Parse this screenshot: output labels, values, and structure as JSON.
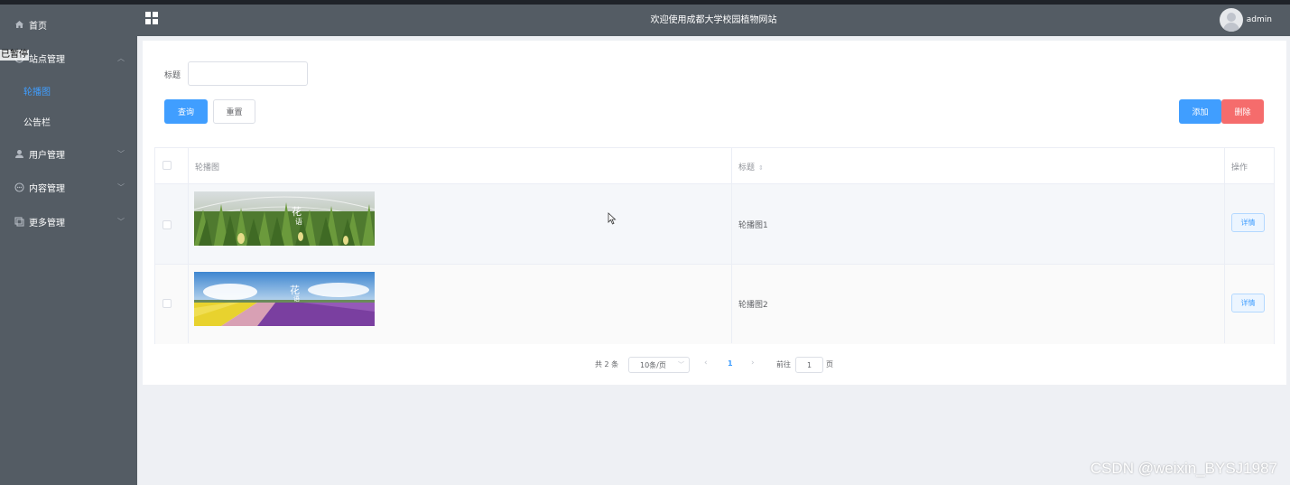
{
  "sidebar": {
    "items": [
      {
        "label": "首页",
        "icon": "home-icon"
      },
      {
        "label": "站点管理",
        "icon": "site-icon",
        "expanded": true,
        "children": [
          {
            "label": "轮播图",
            "active": true
          },
          {
            "label": "公告栏",
            "active": false
          }
        ]
      },
      {
        "label": "用户管理",
        "icon": "user-icon"
      },
      {
        "label": "内容管理",
        "icon": "chat-icon"
      },
      {
        "label": "更多管理",
        "icon": "copy-icon"
      }
    ],
    "paused_overlay": "已暂停"
  },
  "header": {
    "title": "欢迎使用成都大学校园植物网站",
    "user": "admin"
  },
  "search": {
    "label": "标题",
    "value": "",
    "query_button": "查询",
    "reset_button": "重置"
  },
  "actions": {
    "add_button": "添加",
    "delete_button": "删除"
  },
  "table": {
    "columns": [
      "轮播图",
      "标题",
      "操作"
    ],
    "rows": [
      {
        "title": "轮播图1",
        "action": "详情"
      },
      {
        "title": "轮播图2",
        "action": "详情"
      }
    ]
  },
  "pagination": {
    "total": "共 2 条",
    "page_size": "10条/页",
    "current_page": "1",
    "goto_label": "前往",
    "goto_value": "1",
    "page_unit": "页"
  },
  "watermark": "CSDN @weixin_BYSJ1987",
  "colors": {
    "sidebar_bg": "#545c64",
    "primary": "#409eff",
    "danger": "#f56c6c",
    "page_bg": "#eef0f4"
  }
}
